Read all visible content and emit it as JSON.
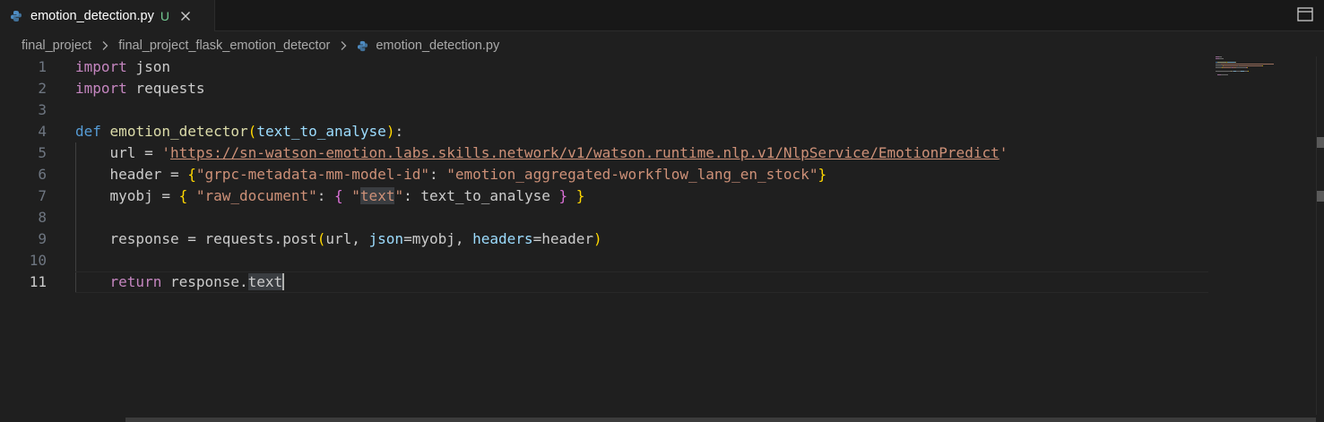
{
  "tab": {
    "label": "emotion_detection.py",
    "status": "U",
    "icon": "python-icon"
  },
  "breadcrumb": {
    "items": [
      "final_project",
      "final_project_flask_emotion_detector",
      "emotion_detection.py"
    ]
  },
  "editor": {
    "active_line": 11,
    "line_numbers": [
      "1",
      "2",
      "3",
      "4",
      "5",
      "6",
      "7",
      "8",
      "9",
      "10",
      "11"
    ],
    "lines": [
      [
        {
          "t": "import",
          "c": "kwc"
        },
        {
          "t": " json",
          "c": ""
        }
      ],
      [
        {
          "t": "import",
          "c": "kwc"
        },
        {
          "t": " requests",
          "c": ""
        }
      ],
      [],
      [
        {
          "t": "def",
          "c": "kw"
        },
        {
          "t": " ",
          "c": ""
        },
        {
          "t": "emotion_detector",
          "c": "fn"
        },
        {
          "t": "(",
          "c": "br1"
        },
        {
          "t": "text_to_analyse",
          "c": "param"
        },
        {
          "t": ")",
          "c": "br1"
        },
        {
          "t": ":",
          "c": ""
        }
      ],
      [
        {
          "t": "    url = ",
          "c": ""
        },
        {
          "t": "'",
          "c": "str"
        },
        {
          "t": "https://sn-watson-emotion.labs.skills.network/v1/watson.runtime.nlp.v1/NlpService/EmotionPredict",
          "c": "str link"
        },
        {
          "t": "'",
          "c": "str"
        }
      ],
      [
        {
          "t": "    header = ",
          "c": ""
        },
        {
          "t": "{",
          "c": "br1"
        },
        {
          "t": "\"grpc-metadata-mm-model-id\"",
          "c": "str"
        },
        {
          "t": ": ",
          "c": ""
        },
        {
          "t": "\"emotion_aggregated-workflow_lang_en_stock\"",
          "c": "str"
        },
        {
          "t": "}",
          "c": "br1"
        }
      ],
      [
        {
          "t": "    myobj = ",
          "c": ""
        },
        {
          "t": "{",
          "c": "br1"
        },
        {
          "t": " ",
          "c": ""
        },
        {
          "t": "\"raw_document\"",
          "c": "str"
        },
        {
          "t": ": ",
          "c": ""
        },
        {
          "t": "{",
          "c": "br2"
        },
        {
          "t": " ",
          "c": ""
        },
        {
          "t": "\"",
          "c": "str"
        },
        {
          "t": "text",
          "c": "str hl"
        },
        {
          "t": "\"",
          "c": "str"
        },
        {
          "t": ": text_to_analyse ",
          "c": ""
        },
        {
          "t": "}",
          "c": "br2"
        },
        {
          "t": " ",
          "c": ""
        },
        {
          "t": "}",
          "c": "br1"
        }
      ],
      [],
      [
        {
          "t": "    response = requests.post",
          "c": ""
        },
        {
          "t": "(",
          "c": "br1"
        },
        {
          "t": "url, ",
          "c": ""
        },
        {
          "t": "json",
          "c": "param"
        },
        {
          "t": "=myobj, ",
          "c": ""
        },
        {
          "t": "headers",
          "c": "param"
        },
        {
          "t": "=header",
          "c": ""
        },
        {
          "t": ")",
          "c": "br1"
        }
      ],
      [],
      [
        {
          "t": "    ",
          "c": ""
        },
        {
          "t": "return",
          "c": "kwc"
        },
        {
          "t": " response.",
          "c": ""
        },
        {
          "t": "text",
          "c": "hl"
        }
      ]
    ]
  },
  "colors": {
    "background": "#1f1f1f",
    "tab_status": "#73c991",
    "keyword": "#569cd6",
    "control_keyword": "#c586c0",
    "function": "#dcdcaa",
    "parameter": "#9cdcfe",
    "string": "#ce9178"
  }
}
